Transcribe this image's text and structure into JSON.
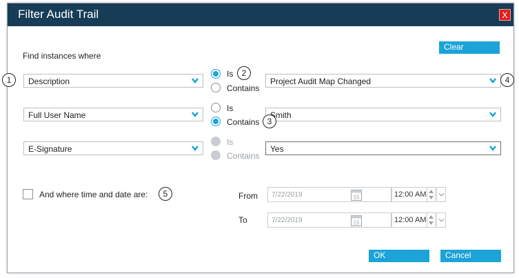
{
  "dialog": {
    "title": "Filter Audit Trail",
    "close_label": "X"
  },
  "toolbar": {
    "clear_label": "Clear"
  },
  "find_label": "Find instances where",
  "rows": [
    {
      "field": "Description",
      "is_label": "Is",
      "contains_label": "Contains",
      "selected": "is",
      "value": "Project Audit Map Changed"
    },
    {
      "field": "Full User Name",
      "is_label": "Is",
      "contains_label": "Contains",
      "selected": "contains",
      "value": "Smith"
    },
    {
      "field": "E-Signature",
      "is_label": "Is",
      "contains_label": "Contains",
      "selected": "disabled",
      "value": "Yes"
    }
  ],
  "time_filter": {
    "checkbox_label": "And where time and date are:",
    "from_label": "From",
    "to_label": "To",
    "from_date": "7/22/2019",
    "to_date": "7/22/2019",
    "from_time": "12:00 AM",
    "to_time": "12:00 AM",
    "calendar_day": "15"
  },
  "callouts": [
    "1",
    "2",
    "3",
    "4",
    "5"
  ],
  "footer": {
    "ok_label": "OK",
    "cancel_label": "Cancel"
  },
  "colors": {
    "titlebar": "#173c56",
    "accent": "#1ca3d8",
    "close": "#e02020"
  }
}
